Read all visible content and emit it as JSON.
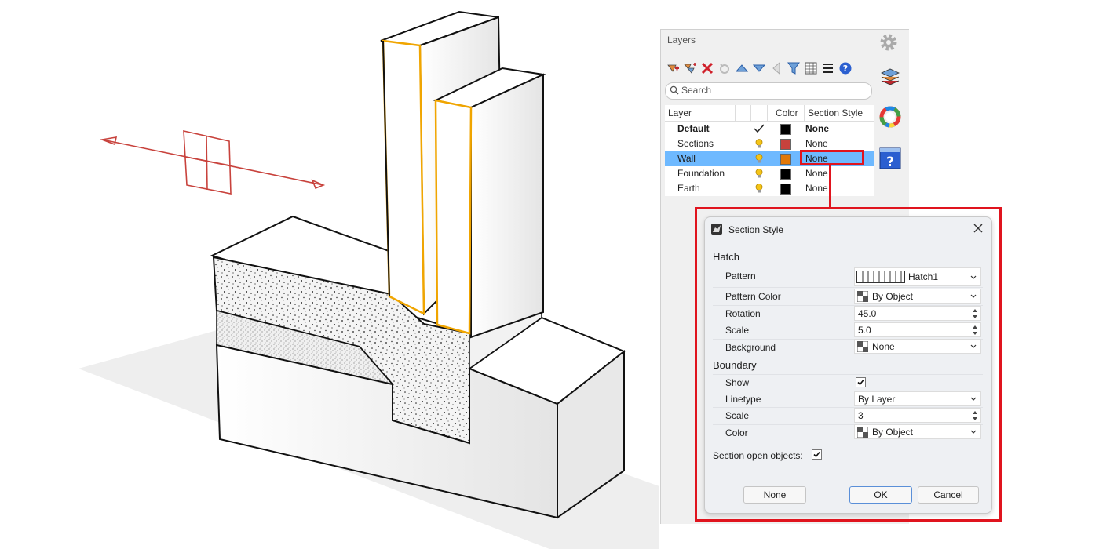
{
  "layers_panel": {
    "title": "Layers",
    "search_placeholder": "Search",
    "columns": {
      "layer": "Layer",
      "color": "Color",
      "section_style": "Section Style"
    },
    "rows": [
      {
        "name": "Default",
        "style": "None",
        "color": "#000000",
        "current": true
      },
      {
        "name": "Sections",
        "style": "None",
        "color": "#c8423c",
        "current": false
      },
      {
        "name": "Wall",
        "style": "None",
        "color": "#e0780a",
        "current": false,
        "selected": true
      },
      {
        "name": "Foundation",
        "style": "None",
        "color": "#000000",
        "current": false
      },
      {
        "name": "Earth",
        "style": "None",
        "color": "#000000",
        "current": false
      }
    ]
  },
  "dialog": {
    "title": "Section Style",
    "hatch": {
      "heading": "Hatch",
      "pattern_label": "Pattern",
      "pattern_value": "Hatch1",
      "pattern_color_label": "Pattern Color",
      "pattern_color_value": "By Object",
      "rotation_label": "Rotation",
      "rotation_value": "45.0",
      "scale_label": "Scale",
      "scale_value": "5.0",
      "background_label": "Background",
      "background_value": "None"
    },
    "boundary": {
      "heading": "Boundary",
      "show_label": "Show",
      "linetype_label": "Linetype",
      "linetype_value": "By Layer",
      "scale_label": "Scale",
      "scale_value": "3",
      "color_label": "Color",
      "color_value": "By Object"
    },
    "section_open_label": "Section open objects:",
    "buttons": {
      "none": "None",
      "ok": "OK",
      "cancel": "Cancel"
    }
  },
  "colors": {
    "accent_red": "#e0141e",
    "selection_blue": "#6eb9ff",
    "wall_edge": "#f0a500"
  }
}
